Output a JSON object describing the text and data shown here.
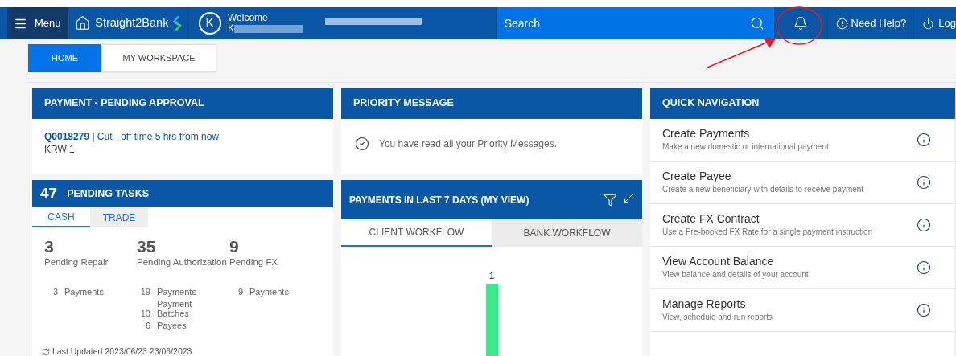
{
  "header": {
    "menu": "Menu",
    "brand": "Straight2Bank",
    "user": {
      "initial": "K",
      "welcome": "Welcome",
      "name_visible": "K"
    },
    "search": {
      "placeholder": "Search"
    },
    "help": "Need Help?",
    "logout": "Log"
  },
  "tabs": [
    {
      "label": "HOME",
      "selected": true
    },
    {
      "label": "MY WORKSPACE",
      "selected": false
    }
  ],
  "payment_pending": {
    "title": "PAYMENT - PENDING APPROVAL",
    "ref": "Q0018279",
    "note": "| Cut - off time 5 hrs from now",
    "amount": "KRW 1"
  },
  "priority": {
    "title": "PRIORITY MESSAGE",
    "message": "You have read all your Priority Messages."
  },
  "pending_tasks": {
    "count": "47",
    "title": "PENDING TASKS",
    "tabs": [
      {
        "label": "CASH",
        "selected": true
      },
      {
        "label": "TRADE",
        "selected": false
      }
    ],
    "groups": [
      {
        "value": "3",
        "label": "Pending Repair",
        "items": [
          {
            "count": "3",
            "label": "Payments"
          }
        ]
      },
      {
        "value": "35",
        "label": "Pending Authorization",
        "items": [
          {
            "count": "19",
            "label": "Payments"
          },
          {
            "count": "10",
            "label": "Payment Batches"
          },
          {
            "count": "6",
            "label": "Payees"
          }
        ]
      },
      {
        "value": "9",
        "label": "Pending FX",
        "items": [
          {
            "count": "9",
            "label": "Payments"
          }
        ]
      }
    ],
    "last_updated": "Last Updated 2023/06/23 23/06/2023"
  },
  "payments_chart": {
    "title": "PAYMENTS IN LAST 7 DAYS (MY VIEW)",
    "tabs": [
      {
        "label": "CLIENT WORKFLOW",
        "selected": true
      },
      {
        "label": "BANK WORKFLOW",
        "selected": false
      }
    ],
    "bar_label": "1"
  },
  "quick_nav": {
    "title": "QUICK NAVIGATION",
    "items": [
      {
        "title": "Create Payments",
        "desc": "Make a new domestic or international payment"
      },
      {
        "title": "Create Payee",
        "desc": "Create a new beneficiary with details to receive payment"
      },
      {
        "title": "Create FX Contract",
        "desc": "Use a Pre-booked FX Rate for a single payment instruction"
      },
      {
        "title": "View Account Balance",
        "desc": "View balance and details of your account"
      },
      {
        "title": "Manage Reports",
        "desc": "View, schedule and run reports"
      }
    ]
  }
}
